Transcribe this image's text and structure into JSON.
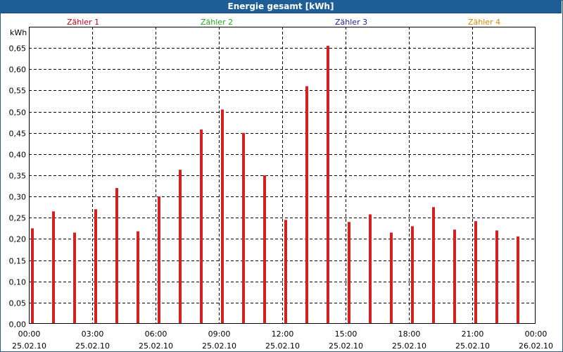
{
  "window": {
    "title": "Energie gesamt [kWh]"
  },
  "legend": [
    {
      "label": "Zähler 1",
      "color": "#c0001a"
    },
    {
      "label": "Zähler 2",
      "color": "#1bb01b"
    },
    {
      "label": "Zähler 3",
      "color": "#1a1aa0"
    },
    {
      "label": "Zähler 4",
      "color": "#d48a00"
    }
  ],
  "chart_data": {
    "type": "bar",
    "ylabel": "kWh",
    "ylim": [
      0,
      0.7
    ],
    "yticks": [
      "0,00",
      "0,05",
      "0,10",
      "0,15",
      "0,20",
      "0,25",
      "0,30",
      "0,35",
      "0,40",
      "0,45",
      "0,50",
      "0,55",
      "0,60",
      "0,65"
    ],
    "xlim_hours": [
      0,
      24
    ],
    "xticks": [
      {
        "time": "00:00",
        "date": "25.02.10"
      },
      {
        "time": "03:00",
        "date": "25.02.10"
      },
      {
        "time": "06:00",
        "date": "25.02.10"
      },
      {
        "time": "09:00",
        "date": "25.02.10"
      },
      {
        "time": "12:00",
        "date": "25.02.10"
      },
      {
        "time": "15:00",
        "date": "25.02.10"
      },
      {
        "time": "18:00",
        "date": "25.02.10"
      },
      {
        "time": "21:00",
        "date": "25.02.10"
      },
      {
        "time": "00:00",
        "date": "26.02.10"
      }
    ],
    "bar_color": "#d42020",
    "grid": true,
    "series": [
      {
        "name": "Zähler 1",
        "x_hours": [
          0,
          1,
          2,
          3,
          4,
          5,
          6,
          7,
          8,
          9,
          10,
          11,
          12,
          13,
          14,
          15,
          16,
          17,
          18,
          19,
          20,
          21,
          22,
          23
        ],
        "values": [
          0.225,
          0.265,
          0.215,
          0.27,
          0.32,
          0.218,
          0.3,
          0.363,
          0.458,
          0.505,
          0.45,
          0.35,
          0.245,
          0.56,
          0.655,
          0.24,
          0.258,
          0.215,
          0.23,
          0.275,
          0.222,
          0.242,
          0.22,
          0.206
        ]
      }
    ]
  }
}
